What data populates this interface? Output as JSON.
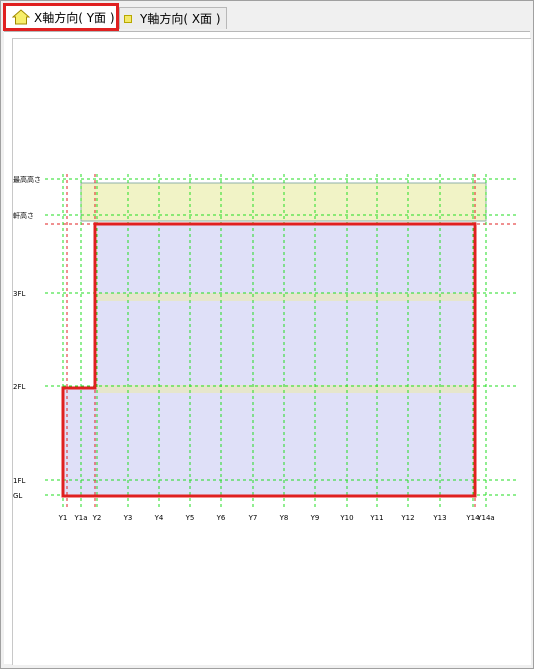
{
  "tabs": [
    {
      "label": "X軸方向( Y面 )",
      "icon": "home-icon",
      "active": true
    },
    {
      "label": "Y軸方向( X面 )",
      "icon": "square-icon",
      "active": false
    }
  ],
  "levels": [
    "最高高さ",
    "軒高さ",
    "3FL",
    "2FL",
    "1FL",
    "GL"
  ],
  "grid_axes": [
    "Y1",
    "Y1a",
    "Y2",
    "Y3",
    "Y4",
    "Y5",
    "Y6",
    "Y7",
    "Y8",
    "Y9",
    "Y10",
    "Y11",
    "Y12",
    "Y13",
    "Y14",
    "Y14a"
  ],
  "colors": {
    "grid": "#22dd22",
    "building_outline": "#e02020",
    "floor_fill": "#dfe0f8",
    "roof_fill": "#f1f3c6",
    "slab_fill": "#e6e6cc",
    "tab_highlight": "#e02020"
  }
}
